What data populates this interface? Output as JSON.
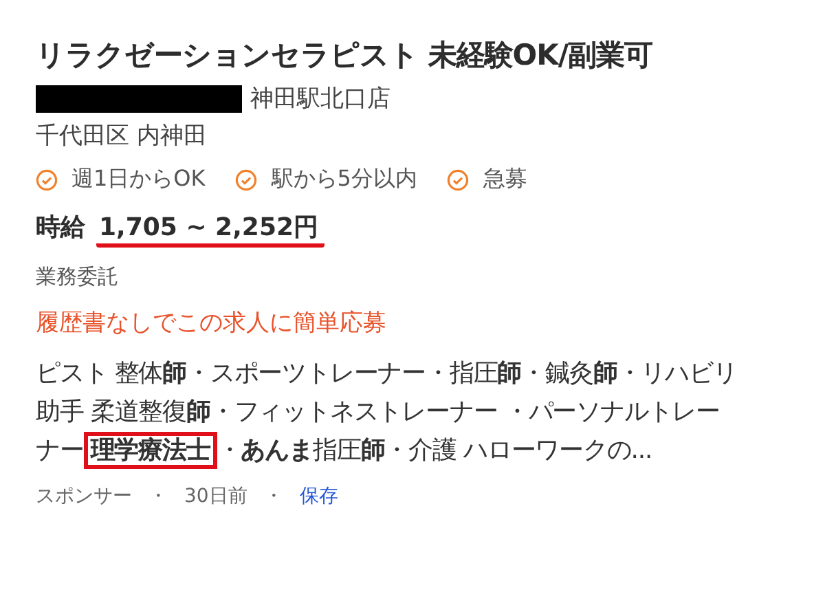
{
  "title": "リラクゼーションセラピスト 未経験OK/副業可",
  "company": {
    "redacted": true,
    "branch": "神田駅北口店"
  },
  "location": "千代田区 内神田",
  "tags": [
    "週1日からOK",
    "駅から5分以内",
    "急募"
  ],
  "salary": {
    "label": "時給",
    "amount": "1,705 ~ 2,252円"
  },
  "employment_type": "業務委託",
  "easy_apply": "履歴書なしでこの求人に簡単応募",
  "description": {
    "before": "ピスト 整体**師**・スポーツトレーナー・指圧**師**・鍼灸**師**・リハビリ助手 柔道整復**師**・フィットネストレーナー ・パーソナルトレーナー",
    "highlight": "理学療法士",
    "after": "・**あんま**指圧**師**・介護 ハローワークの..."
  },
  "footer": {
    "sponsor": "スポンサー",
    "separators": [
      "・",
      "・"
    ],
    "age": "30日前",
    "save": "保存"
  }
}
